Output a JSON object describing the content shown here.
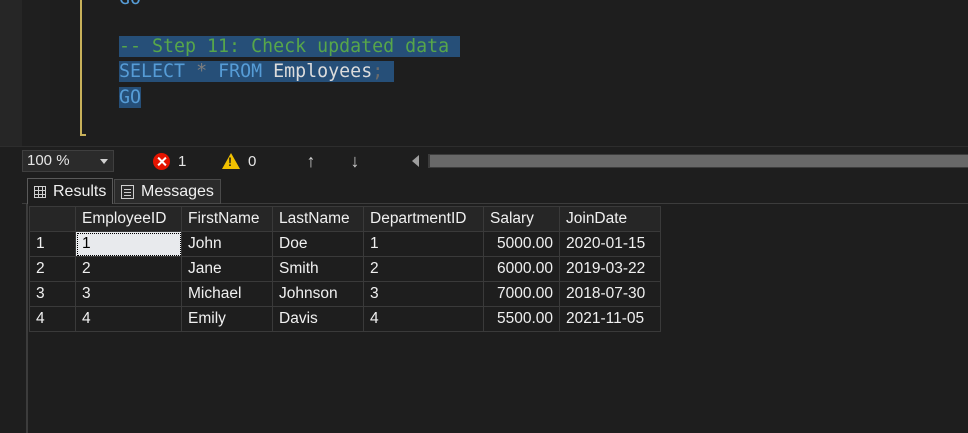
{
  "editor": {
    "lines": [
      {
        "comment": "-- Step 11: Check updated data"
      },
      {
        "kw1": "SELECT",
        "op": "*",
        "kw2": "FROM",
        "ident": "Employees",
        "punct": ";"
      },
      {
        "kw": "GO"
      }
    ]
  },
  "statusbar": {
    "zoom": "100 %",
    "errors": "1",
    "warnings": "0",
    "up_arrow": "↑",
    "down_arrow": "↓"
  },
  "tabs": {
    "results": "Results",
    "messages": "Messages"
  },
  "results": {
    "columns": [
      "EmployeeID",
      "FirstName",
      "LastName",
      "DepartmentID",
      "Salary",
      "JoinDate"
    ],
    "rows": [
      {
        "n": "1",
        "EmployeeID": "1",
        "FirstName": "John",
        "LastName": "Doe",
        "DepartmentID": "1",
        "Salary": "5000.00",
        "JoinDate": "2020-01-15"
      },
      {
        "n": "2",
        "EmployeeID": "2",
        "FirstName": "Jane",
        "LastName": "Smith",
        "DepartmentID": "2",
        "Salary": "6000.00",
        "JoinDate": "2019-03-22"
      },
      {
        "n": "3",
        "EmployeeID": "3",
        "FirstName": "Michael",
        "LastName": "Johnson",
        "DepartmentID": "3",
        "Salary": "7000.00",
        "JoinDate": "2018-07-30"
      },
      {
        "n": "4",
        "EmployeeID": "4",
        "FirstName": "Emily",
        "LastName": "Davis",
        "DepartmentID": "4",
        "Salary": "5500.00",
        "JoinDate": "2021-11-05"
      }
    ]
  },
  "colors": {
    "selection": "#264f78",
    "comment": "#57a64a",
    "keyword": "#569cd6",
    "error": "#e51400",
    "warning": "#f0c000"
  }
}
